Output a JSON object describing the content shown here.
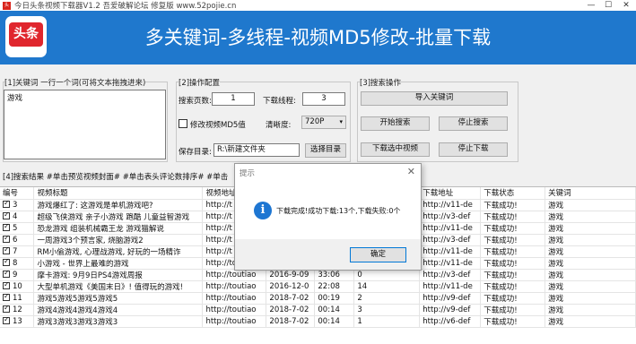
{
  "window": {
    "title": "今日头条视频下载器V1.2  吾爱破解论坛 修复版  www.52pojie.cn",
    "app_icon_text": "头条",
    "min": "—",
    "max": "☐",
    "close": "✕"
  },
  "banner": {
    "logo_text": "头条",
    "headline": "多关键词-多线程-视频MD5修改-批量下载"
  },
  "keywords_panel": {
    "title": "[1]关键词 一行一个词(可将文本拖拽进来)",
    "value": "游戏"
  },
  "ops_panel": {
    "title": "[2]操作配置",
    "pages_label": "搜索页数:",
    "pages_value": "1",
    "threads_label": "下载线程:",
    "threads_value": "3",
    "md5_label": "修改视频MD5值",
    "clarity_label": "清晰度:",
    "clarity_value": "720P",
    "save_label": "保存目录:",
    "save_value": "R:\\新建文件夹",
    "choose_dir": "选择目录"
  },
  "search_panel": {
    "title": "[3]搜索操作",
    "import_kw": "导入关键词",
    "start_search": "开始搜索",
    "stop_search": "停止搜索",
    "download_selected": "下载选中视频",
    "stop_download": "停止下载"
  },
  "results": {
    "hint": "[4]搜索结果 #单击预览视频封面# #单击表头评论数排序# #单击",
    "columns": [
      "编号",
      "视频标题",
      "视频地址",
      "",
      "",
      "",
      "下载地址",
      "下载状态",
      "关键词"
    ],
    "rows": [
      [
        "3",
        "游戏爆红了: 这游戏是单机游戏吧?",
        "http://t",
        "",
        "",
        "",
        "http://v11-de",
        "下载成功!",
        "游戏"
      ],
      [
        "4",
        "超级飞侠游戏 亲子小游戏 跑酷 儿童益智游戏",
        "http://t",
        "",
        "",
        "",
        "http://v3-def",
        "下载成功!",
        "游戏"
      ],
      [
        "5",
        "恐龙游戏 组装机械霸王龙 游戏猫解说",
        "http://t",
        "",
        "",
        "",
        "http://v11-de",
        "下载成功!",
        "游戏"
      ],
      [
        "6",
        "一周游戏3个预言家, 烧脑游戏2",
        "http://t",
        "",
        "",
        "",
        "http://v3-def",
        "下载成功!",
        "游戏"
      ],
      [
        "7",
        "RM小偷游戏, 心理战游戏, 好玩的一场精诈",
        "http://t",
        "",
        "",
        "",
        "http://v11-de",
        "下载成功!",
        "游戏"
      ],
      [
        "8",
        "小游戏 - 世界上最难的游戏",
        "http://toutiao",
        "2014-3-20",
        "15:03",
        "26",
        "http://v11-de",
        "下载成功!",
        "游戏"
      ],
      [
        "9",
        "摩卡游戏: 9月9日PS4游戏周报",
        "http://toutiao",
        "2016-9-09",
        "33:06",
        "0",
        "http://v3-def",
        "下载成功!",
        "游戏"
      ],
      [
        "10",
        "大型单机游戏《美国末日》! 值得玩的游戏!",
        "http://toutiao",
        "2016-12-0",
        "22:08",
        "14",
        "http://v11-de",
        "下载成功!",
        "游戏"
      ],
      [
        "11",
        "游戏5游戏5游戏5游戏5",
        "http://toutiao",
        "2018-7-02",
        "00:19",
        "2",
        "http://v9-def",
        "下载成功!",
        "游戏"
      ],
      [
        "12",
        "游戏4游戏4游戏4游戏4",
        "http://toutiao",
        "2018-7-02",
        "00:14",
        "3",
        "http://v9-def",
        "下载成功!",
        "游戏"
      ],
      [
        "13",
        "游戏3游戏3游戏3游戏3",
        "http://toutiao",
        "2018-7-02",
        "00:14",
        "1",
        "http://v6-def",
        "下载成功!",
        "游戏"
      ]
    ]
  },
  "dialog": {
    "title": "提示",
    "icon": "i",
    "message": "下载完成!成功下载:13个,下载失败:0个",
    "ok": "确定"
  },
  "colors": {
    "banner": "#1f78cd",
    "logo_red": "#e0262d",
    "info_blue": "#1e76d2"
  }
}
